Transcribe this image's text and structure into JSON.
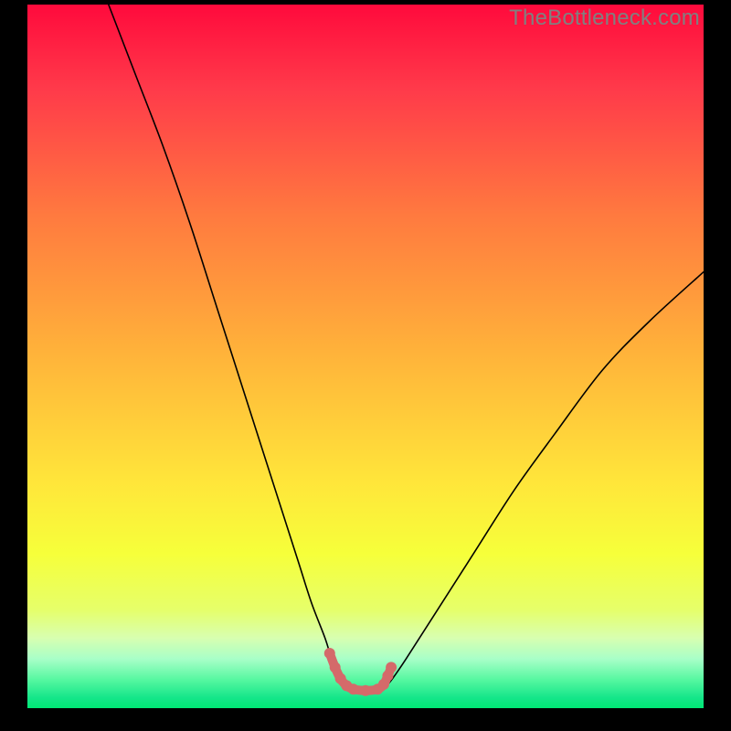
{
  "watermark": "TheBottleneck.com",
  "chart_data": {
    "type": "line",
    "title": "",
    "xlabel": "",
    "ylabel": "",
    "xlim": [
      0,
      100
    ],
    "ylim": [
      0,
      100
    ],
    "grid": false,
    "background": {
      "type": "vertical-gradient",
      "stops": [
        {
          "pos": 0.0,
          "color": "#ff0a3c"
        },
        {
          "pos": 0.12,
          "color": "#ff3a4a"
        },
        {
          "pos": 0.3,
          "color": "#ff7a3f"
        },
        {
          "pos": 0.5,
          "color": "#ffb43a"
        },
        {
          "pos": 0.68,
          "color": "#ffe63a"
        },
        {
          "pos": 0.78,
          "color": "#f6ff3a"
        },
        {
          "pos": 0.86,
          "color": "#e6ff6a"
        },
        {
          "pos": 0.9,
          "color": "#d8ffb0"
        },
        {
          "pos": 0.93,
          "color": "#a8ffc8"
        },
        {
          "pos": 0.96,
          "color": "#55f7a0"
        },
        {
          "pos": 0.985,
          "color": "#15e68a"
        },
        {
          "pos": 1.0,
          "color": "#00e874"
        }
      ]
    },
    "series": [
      {
        "name": "bottleneck-curve",
        "color": "#000000",
        "stroke_width": 1.6,
        "x": [
          12,
          16,
          20,
          24,
          28,
          32,
          36,
          40,
          42,
          44,
          45,
          46,
          47,
          48,
          50,
          52,
          53,
          54,
          56,
          60,
          66,
          72,
          78,
          85,
          92,
          100
        ],
        "y": [
          100,
          90,
          80,
          69,
          57,
          45,
          33,
          21,
          15,
          10,
          7,
          5,
          3.5,
          2.7,
          2.5,
          2.6,
          3.1,
          4.2,
          7,
          13,
          22,
          31,
          39,
          48,
          55,
          62
        ]
      },
      {
        "name": "highlight-band",
        "color": "#d46a6a",
        "stroke_width": 10,
        "markers": true,
        "marker_radius": 6,
        "x": [
          44.7,
          45.5,
          46.3,
          47.2,
          48.2,
          50.0,
          51.8,
          52.7,
          53.3,
          53.8
        ],
        "y": [
          7.8,
          5.8,
          4.2,
          3.2,
          2.7,
          2.5,
          2.7,
          3.4,
          4.6,
          5.8
        ]
      }
    ]
  }
}
